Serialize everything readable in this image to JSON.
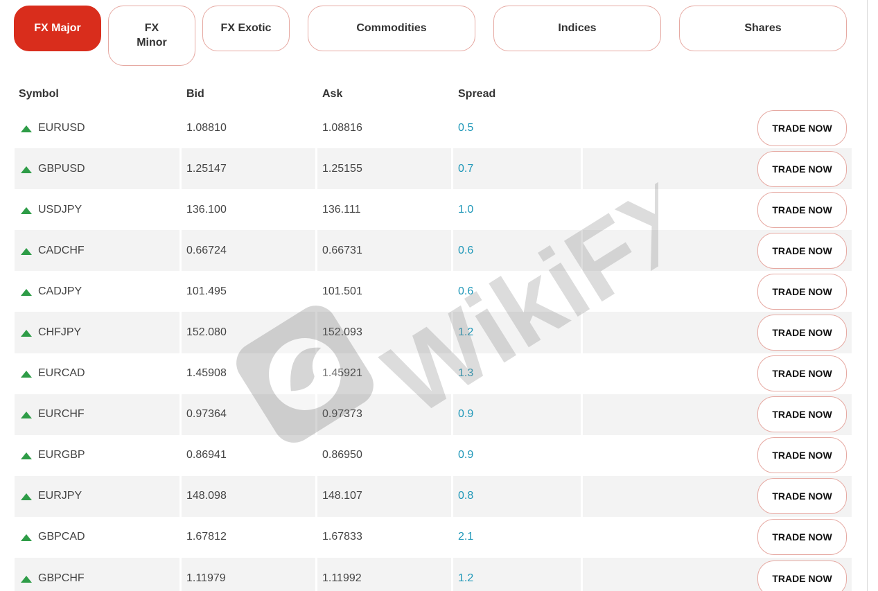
{
  "tabs": [
    {
      "label": "FX Major",
      "active": true
    },
    {
      "label": "FX\nMinor",
      "active": false
    },
    {
      "label": "FX Exotic",
      "active": false
    },
    {
      "label": "Commodities",
      "active": false
    },
    {
      "label": "Indices",
      "active": false
    },
    {
      "label": "Shares",
      "active": false
    }
  ],
  "table": {
    "headers": {
      "symbol": "Symbol",
      "bid": "Bid",
      "ask": "Ask",
      "spread": "Spread"
    },
    "trade_label": "TRADE NOW",
    "rows": [
      {
        "symbol": "EURUSD",
        "bid": "1.08810",
        "ask": "1.08816",
        "spread": "0.5",
        "trend": "up"
      },
      {
        "symbol": "GBPUSD",
        "bid": "1.25147",
        "ask": "1.25155",
        "spread": "0.7",
        "trend": "up"
      },
      {
        "symbol": "USDJPY",
        "bid": "136.100",
        "ask": "136.111",
        "spread": "1.0",
        "trend": "up"
      },
      {
        "symbol": "CADCHF",
        "bid": "0.66724",
        "ask": "0.66731",
        "spread": "0.6",
        "trend": "up"
      },
      {
        "symbol": "CADJPY",
        "bid": "101.495",
        "ask": "101.501",
        "spread": "0.6",
        "trend": "up"
      },
      {
        "symbol": "CHFJPY",
        "bid": "152.080",
        "ask": "152.093",
        "spread": "1.2",
        "trend": "up"
      },
      {
        "symbol": "EURCAD",
        "bid": "1.45908",
        "ask": "1.45921",
        "spread": "1.3",
        "trend": "up"
      },
      {
        "symbol": "EURCHF",
        "bid": "0.97364",
        "ask": "0.97373",
        "spread": "0.9",
        "trend": "up"
      },
      {
        "symbol": "EURGBP",
        "bid": "0.86941",
        "ask": "0.86950",
        "spread": "0.9",
        "trend": "up"
      },
      {
        "symbol": "EURJPY",
        "bid": "148.098",
        "ask": "148.107",
        "spread": "0.8",
        "trend": "up"
      },
      {
        "symbol": "GBPCAD",
        "bid": "1.67812",
        "ask": "1.67833",
        "spread": "2.1",
        "trend": "up"
      },
      {
        "symbol": "GBPCHF",
        "bid": "1.11979",
        "ask": "1.11992",
        "spread": "1.2",
        "trend": "up"
      }
    ]
  },
  "watermark": {
    "text": "WikiFX"
  },
  "colors": {
    "accent": "#d92d1c",
    "up_arrow": "#2e9c47",
    "spread_text": "#1e97b8",
    "alt_row": "#f3f3f3"
  }
}
